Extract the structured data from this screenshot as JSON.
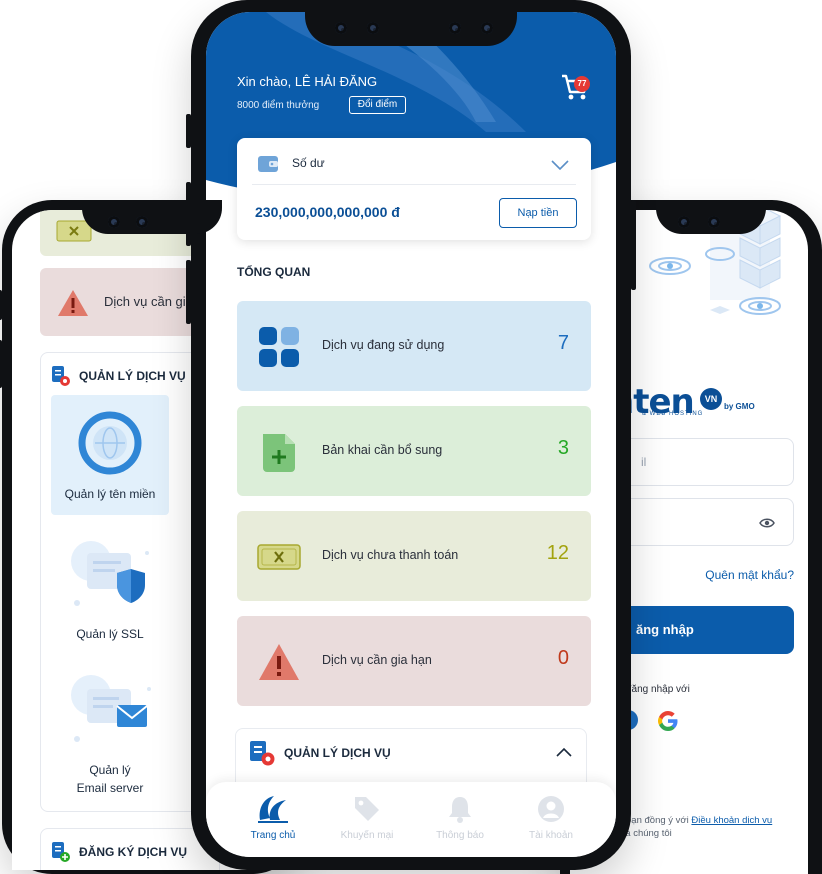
{
  "colors": {
    "primary": "#0b5cab",
    "badge": "#e53935",
    "service_blue": "#1d6dbf",
    "declaration_green": "#26a826",
    "unpaid_olive": "#a3a30f",
    "renew_red": "#c0391b"
  },
  "left_phone": {
    "renew_text": "Dịch vụ cần gia",
    "manage_title": "QUẢN LÝ DỊCH VỤ",
    "tiles": [
      {
        "label": "Quản lý tên miền",
        "icon": "globe-icon"
      },
      {
        "label": "Quản lý SSL",
        "icon": "shield-icon"
      },
      {
        "label_line1": "Quản lý",
        "label_line2": "Email server",
        "icon": "mail-icon"
      }
    ],
    "register_title": "ĐĂNG KÝ DỊCH VỤ"
  },
  "center_phone": {
    "greeting": "Xin chào, LÊ HẢI ĐĂNG",
    "points": "8000 điểm thưởng",
    "redeem_label": "Đổi điểm",
    "cart_badge": "77",
    "balance_label": "Số dư",
    "balance_amount": "230,000,000,000,000 đ",
    "topup_label": "Nạp tiền",
    "overview_title": "TỔNG QUAN",
    "stats": [
      {
        "label": "Dịch vụ đang sử dụng",
        "value": "7"
      },
      {
        "label": "Bản khai cần bổ sung",
        "value": "3"
      },
      {
        "label": "Dịch vụ chưa thanh toán",
        "value": "12"
      },
      {
        "label": "Dịch vụ cần gia hạn",
        "value": "0"
      }
    ],
    "manage_title": "QUẢN LÝ DỊCH VỤ",
    "nav": [
      {
        "label": "Trang chủ",
        "icon": "home-swoosh-icon"
      },
      {
        "label": "Khuyến mại",
        "icon": "tag-icon"
      },
      {
        "label": "Thông báo",
        "icon": "bell-icon"
      },
      {
        "label": "Tài khoản",
        "icon": "user-icon"
      }
    ]
  },
  "right_phone": {
    "logo_text": "nten",
    "logo_vn": "VN",
    "logo_gmo": "by GMO",
    "logo_sub": "& WEB HOSTING",
    "email_placeholder_fragment": "il",
    "forgot_password": "Quên mật khẩu?",
    "login_label": "ăng nhập",
    "or_login_with": "đăng nhập với",
    "terms_prefix": "\" bạn đồng ý với",
    "terms_link": "Điều khoản dịch vụ",
    "terms_suffix": "ủa chúng tôi"
  }
}
